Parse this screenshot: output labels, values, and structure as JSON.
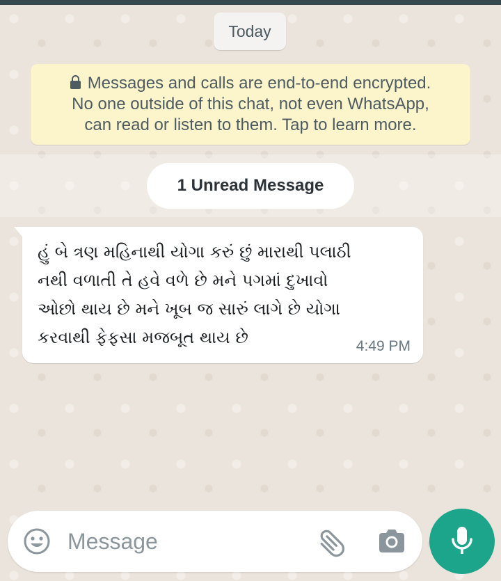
{
  "date_chip": {
    "label": "Today"
  },
  "encryption_notice": {
    "lines": [
      "Messages and calls are end-to-end encrypted.",
      "No one outside of this chat, not even WhatsApp,",
      "can read or listen to them. Tap to learn more."
    ],
    "icon": "lock-icon"
  },
  "unread_banner": {
    "label": "1 Unread Message"
  },
  "messages": [
    {
      "direction": "incoming",
      "lines": [
        "હું બે ત્રણ મહિનાથી યોગા કરું છું મારાથી પલાઠી",
        "નથી વળાતી તે હવે વળે છે મને પગમાં દુખાવો",
        "ઓછો થાય છે મને ખૂબ જ સારું લાગે છે યોગા",
        "કરવાથી ફેફસા મજબૂત થાય છે"
      ],
      "time": "4:49 PM"
    }
  ],
  "composer": {
    "placeholder": "Message",
    "value": "",
    "icons": [
      "emoji-icon",
      "attach-icon",
      "camera-icon",
      "mic-icon"
    ]
  },
  "colors": {
    "header": "#35474f",
    "wallpaper": "#ebe4dc",
    "notice_bg": "#fcf4cb",
    "bubble_bg": "#ffffff",
    "mic_button": "#1ca58a",
    "icon_gray": "#8a959c"
  }
}
